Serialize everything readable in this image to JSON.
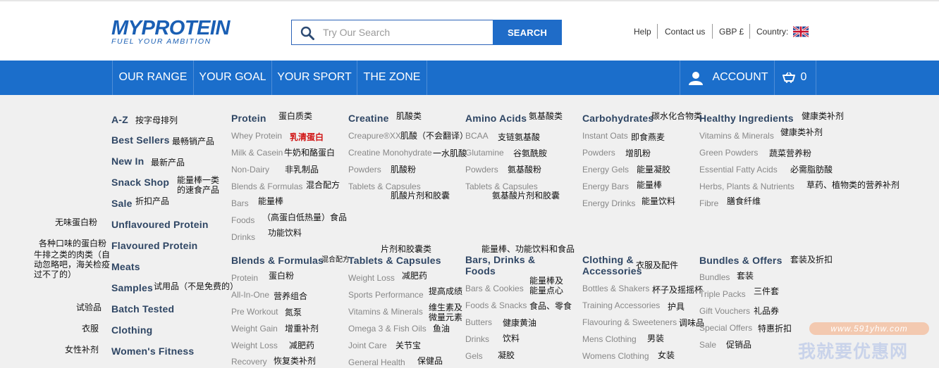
{
  "header": {
    "logo_text": "MYPROTEIN",
    "logo_tagline": "FUEL YOUR AMBITION",
    "search_placeholder": "Try Our Search",
    "search_button": "SEARCH",
    "links": [
      "Help",
      "Contact us",
      "GBP £",
      "Country:"
    ]
  },
  "nav": {
    "items": [
      "OUR RANGE",
      "YOUR GOAL",
      "YOUR SPORT",
      "THE ZONE"
    ],
    "account": "ACCOUNT",
    "basket_count": "0"
  },
  "menu": {
    "left_column": [
      {
        "label": "A-Z",
        "note": "按字母排列"
      },
      {
        "label": "Best Sellers",
        "note": "最畅销产品"
      },
      {
        "label": "New In",
        "note": "最新产品"
      },
      {
        "label": "Snack Shop",
        "note": "能量棒一类\n的速食产品"
      },
      {
        "label": "Sale",
        "note": "折扣产品"
      },
      {
        "label": "Unflavoured Protein",
        "note": "无味蛋白粉"
      },
      {
        "label": "Flavoured Protein",
        "note": "各种口味的蛋白粉"
      },
      {
        "label": "Meats",
        "note": "牛排之类的肉类（自\n动忽略吧，海关检疫\n过不了的）"
      },
      {
        "label": "Samples",
        "note": "试用品（不是免费的）"
      },
      {
        "label": "Batch Tested",
        "note": "试验品"
      },
      {
        "label": "Clothing",
        "note": "衣服"
      },
      {
        "label": "Women's Fitness",
        "note": "女性补剂"
      }
    ],
    "protein": {
      "title": "Protein",
      "title_note": "蛋白质类",
      "items": [
        {
          "label": "Whey Protein",
          "note": "乳清蛋白"
        },
        {
          "label": "Milk & Casein",
          "note": "牛奶和酪蛋白"
        },
        {
          "label": "Non-Dairy",
          "note": "非乳制品"
        },
        {
          "label": "Blends & Formulas",
          "note": "混合配方"
        },
        {
          "label": "Bars",
          "note": "能量棒"
        },
        {
          "label": "Foods",
          "note": "（高蛋白低热量）食品"
        },
        {
          "label": "Drinks",
          "note": "功能饮料"
        }
      ]
    },
    "creatine": {
      "title": "Creatine",
      "title_note": "肌酸类",
      "items": [
        {
          "label": "Creapure®XX",
          "note": "肌酸（不会翻译）"
        },
        {
          "label": "Creatine Monohydrate",
          "note": "一水肌酸"
        },
        {
          "label": "Powders",
          "note": "肌酸粉"
        },
        {
          "label": "Tablets & Capsules",
          "note": "肌酸片剂和胶囊"
        }
      ]
    },
    "amino": {
      "title": "Amino Acids",
      "title_note": "氨基酸类",
      "items": [
        {
          "label": "BCAA",
          "note": "支链氨基酸"
        },
        {
          "label": "Glutamine",
          "note": "谷氨酰胺"
        },
        {
          "label": "Powders",
          "note": "氨基酸粉"
        },
        {
          "label": "Tablets & Capsules",
          "note": "氨基酸片剂和胶囊"
        }
      ]
    },
    "carbs": {
      "title": "Carbohydrates",
      "title_note": "碳水化合物类",
      "items": [
        {
          "label": "Instant Oats",
          "note": "即食燕麦"
        },
        {
          "label": "Powders",
          "note": "增肌粉"
        },
        {
          "label": "Energy Gels",
          "note": "能量凝胶"
        },
        {
          "label": "Energy Bars",
          "note": "能量棒"
        },
        {
          "label": "Energy Drinks",
          "note": "能量饮料"
        }
      ]
    },
    "healthy": {
      "title": "Healthy Ingredients",
      "title_note": "健康类补剂",
      "items": [
        {
          "label": "Vitamins & Minerals",
          "note": "健康类补剂"
        },
        {
          "label": "Green Powders",
          "note": "蔬菜营养粉"
        },
        {
          "label": "Essential Fatty Acids",
          "note": "必需脂肪酸"
        },
        {
          "label": "Herbs, Plants & Nutrients",
          "note": "草药、植物类的营养补剂"
        },
        {
          "label": "Fibre",
          "note": "膳食纤维"
        }
      ]
    },
    "blends": {
      "title": "Blends & Formulas",
      "title_note": "混合配方",
      "items": [
        {
          "label": "Protein",
          "note": "蛋白粉"
        },
        {
          "label": "All-In-One",
          "note": "营养组合"
        },
        {
          "label": "Pre Workout",
          "note": "氮泵"
        },
        {
          "label": "Weight Gain",
          "note": "增重补剂"
        },
        {
          "label": "Weight Loss",
          "note": "减肥药"
        },
        {
          "label": "Recovery",
          "note": "恢复类补剂"
        }
      ]
    },
    "tablets": {
      "title": "Tablets & Capsules",
      "title_note": "片剂和胶囊类",
      "items": [
        {
          "label": "Weight Loss",
          "note": "减肥药"
        },
        {
          "label": "Sports Performance",
          "note": "提高成绩"
        },
        {
          "label": "Vitamins & Minerals",
          "note": "维生素及\n微量元素"
        },
        {
          "label": "Omega 3 & Fish Oils",
          "note": "鱼油"
        },
        {
          "label": "Joint Care",
          "note": "关节宝"
        },
        {
          "label": "General Health",
          "note": "保健品"
        }
      ]
    },
    "bars": {
      "title": "Bars, Drinks &\nFoods",
      "title_note": "能量棒、功能饮料和食品",
      "items": [
        {
          "label": "Bars & Cookies",
          "note": "能量棒及\n能量点心"
        },
        {
          "label": "Foods & Snacks",
          "note": "食品、零食"
        },
        {
          "label": "Butters",
          "note": "健康黄油"
        },
        {
          "label": "Drinks",
          "note": "饮料"
        },
        {
          "label": "Gels",
          "note": "凝胶"
        }
      ]
    },
    "clothing": {
      "title": "Clothing &\nAccessories",
      "title_note": "衣服及配件",
      "items": [
        {
          "label": "Bottles & Shakers",
          "note": "杯子及摇摇杯"
        },
        {
          "label": "Training Accessories",
          "note": "护具"
        },
        {
          "label": "Flavouring & Sweeteners",
          "note": "调味品"
        },
        {
          "label": "Mens Clothing",
          "note": "男装"
        },
        {
          "label": "Womens Clothing",
          "note": "女装"
        }
      ]
    },
    "bundles": {
      "title": "Bundles & Offers",
      "title_note": "套装及折扣",
      "items": [
        {
          "label": "Bundles",
          "note": "套装"
        },
        {
          "label": "Triple Packs",
          "note": "三件套"
        },
        {
          "label": "Gift Vouchers",
          "note": "礼品券"
        },
        {
          "label": "Special Offers",
          "note": "特惠折扣"
        },
        {
          "label": "Sale",
          "note": "促销品"
        }
      ]
    }
  },
  "watermark": {
    "url": "www.591yhw.com",
    "text": "我就要优惠网"
  },
  "colors": {
    "brand_blue": "#1b6ecb",
    "heading": "#2f4664",
    "link_grey": "#888888",
    "highlight_red": "#d01010"
  }
}
